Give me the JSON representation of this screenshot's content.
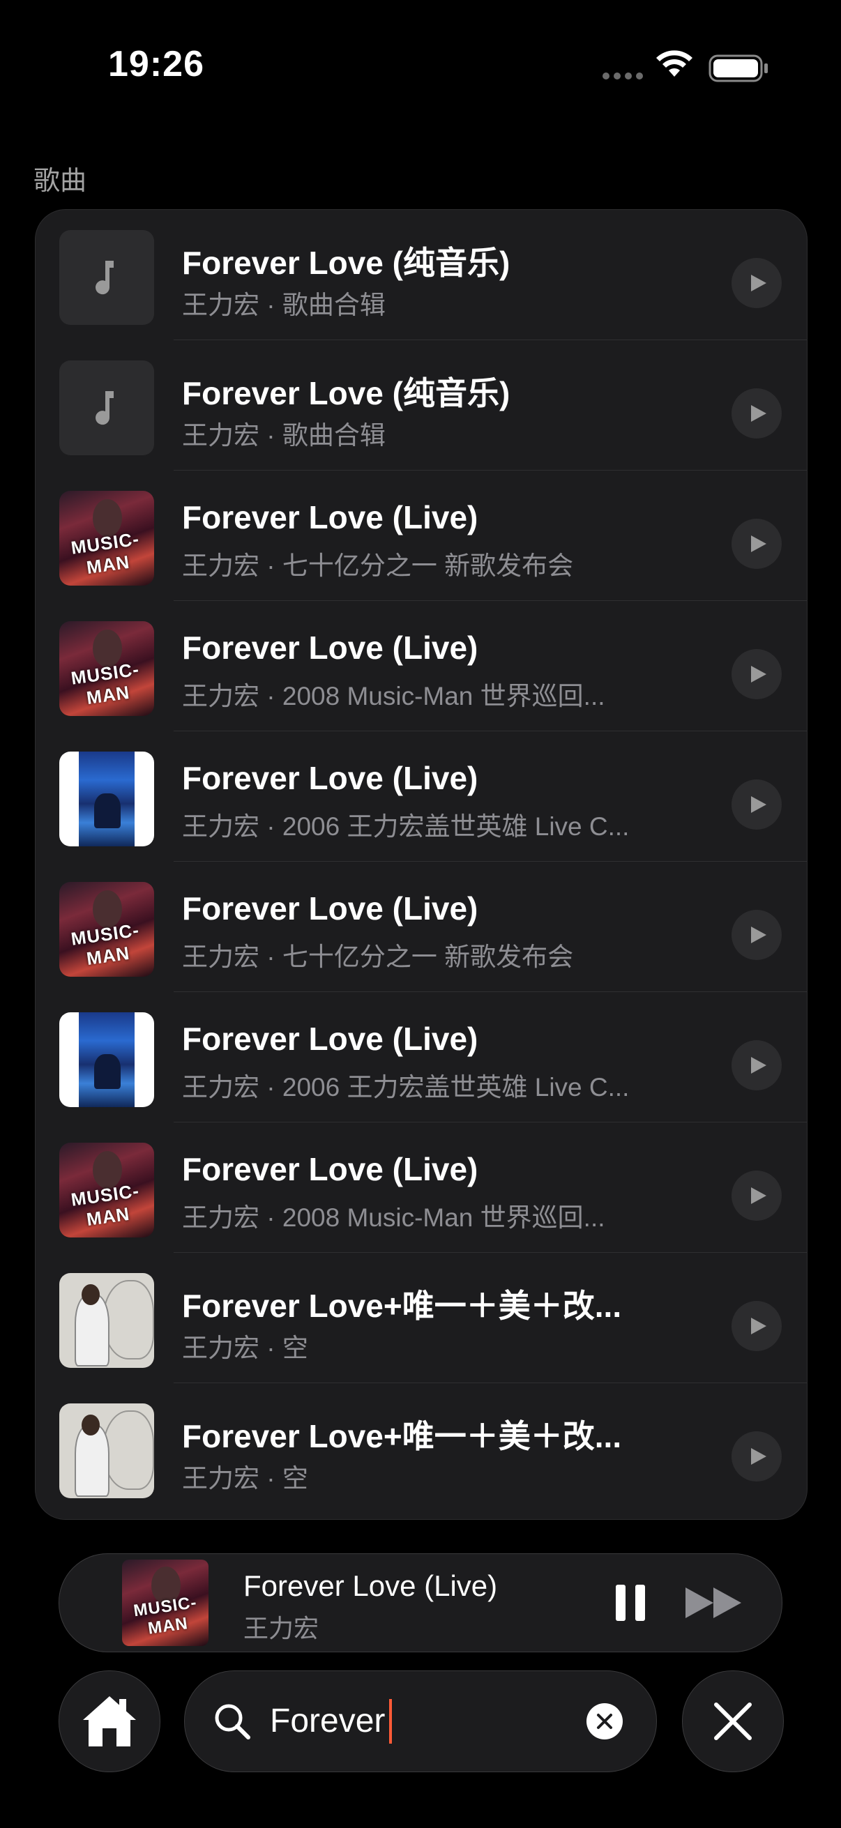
{
  "status_bar": {
    "time": "19:26",
    "icons": [
      "signal-dots-icon",
      "wifi-icon",
      "battery-icon"
    ]
  },
  "section": {
    "title": "歌曲"
  },
  "songs": [
    {
      "title": "Forever Love (纯音乐)",
      "subtitle": "王力宏 · 歌曲合辑",
      "artwork": "music-note-icon"
    },
    {
      "title": "Forever Love (纯音乐)",
      "subtitle": "王力宏 · 歌曲合辑",
      "artwork": "music-note-icon"
    },
    {
      "title": "Forever Love (Live)",
      "subtitle": "王力宏 · 七十亿分之一 新歌发布会",
      "artwork": "music-man-cover",
      "artwork_text": "MUSIC-MAN"
    },
    {
      "title": "Forever Love (Live)",
      "subtitle": "王力宏 · 2008 Music-Man 世界巡回...",
      "artwork": "music-man-cover",
      "artwork_text": "MUSIC-MAN"
    },
    {
      "title": "Forever Love (Live)",
      "subtitle": "王力宏 · 2006 王力宏盖世英雄 Live C...",
      "artwork": "gaishi-yingxiong-cover"
    },
    {
      "title": "Forever Love (Live)",
      "subtitle": "王力宏 · 七十亿分之一 新歌发布会",
      "artwork": "music-man-cover",
      "artwork_text": "MUSIC-MAN"
    },
    {
      "title": "Forever Love (Live)",
      "subtitle": "王力宏 · 2006 王力宏盖世英雄 Live C...",
      "artwork": "gaishi-yingxiong-cover"
    },
    {
      "title": "Forever Love (Live)",
      "subtitle": "王力宏 · 2008 Music-Man 世界巡回...",
      "artwork": "music-man-cover",
      "artwork_text": "MUSIC-MAN"
    },
    {
      "title": "Forever Love+唯一＋美＋改...",
      "subtitle": "王力宏 · 空",
      "artwork": "kong-cover"
    },
    {
      "title": "Forever Love+唯一＋美＋改...",
      "subtitle": "王力宏 · 空",
      "artwork": "kong-cover"
    }
  ],
  "now_playing": {
    "title": "Forever Love (Live)",
    "artist": "王力宏",
    "artwork_text": "MUSIC-MAN",
    "state": "playing"
  },
  "search": {
    "value": "Forever",
    "icon": "search-icon"
  },
  "colors": {
    "background": "#000000",
    "card": "#1c1c1e",
    "secondary_text": "#8e8e93",
    "caret": "#ff5a36"
  }
}
